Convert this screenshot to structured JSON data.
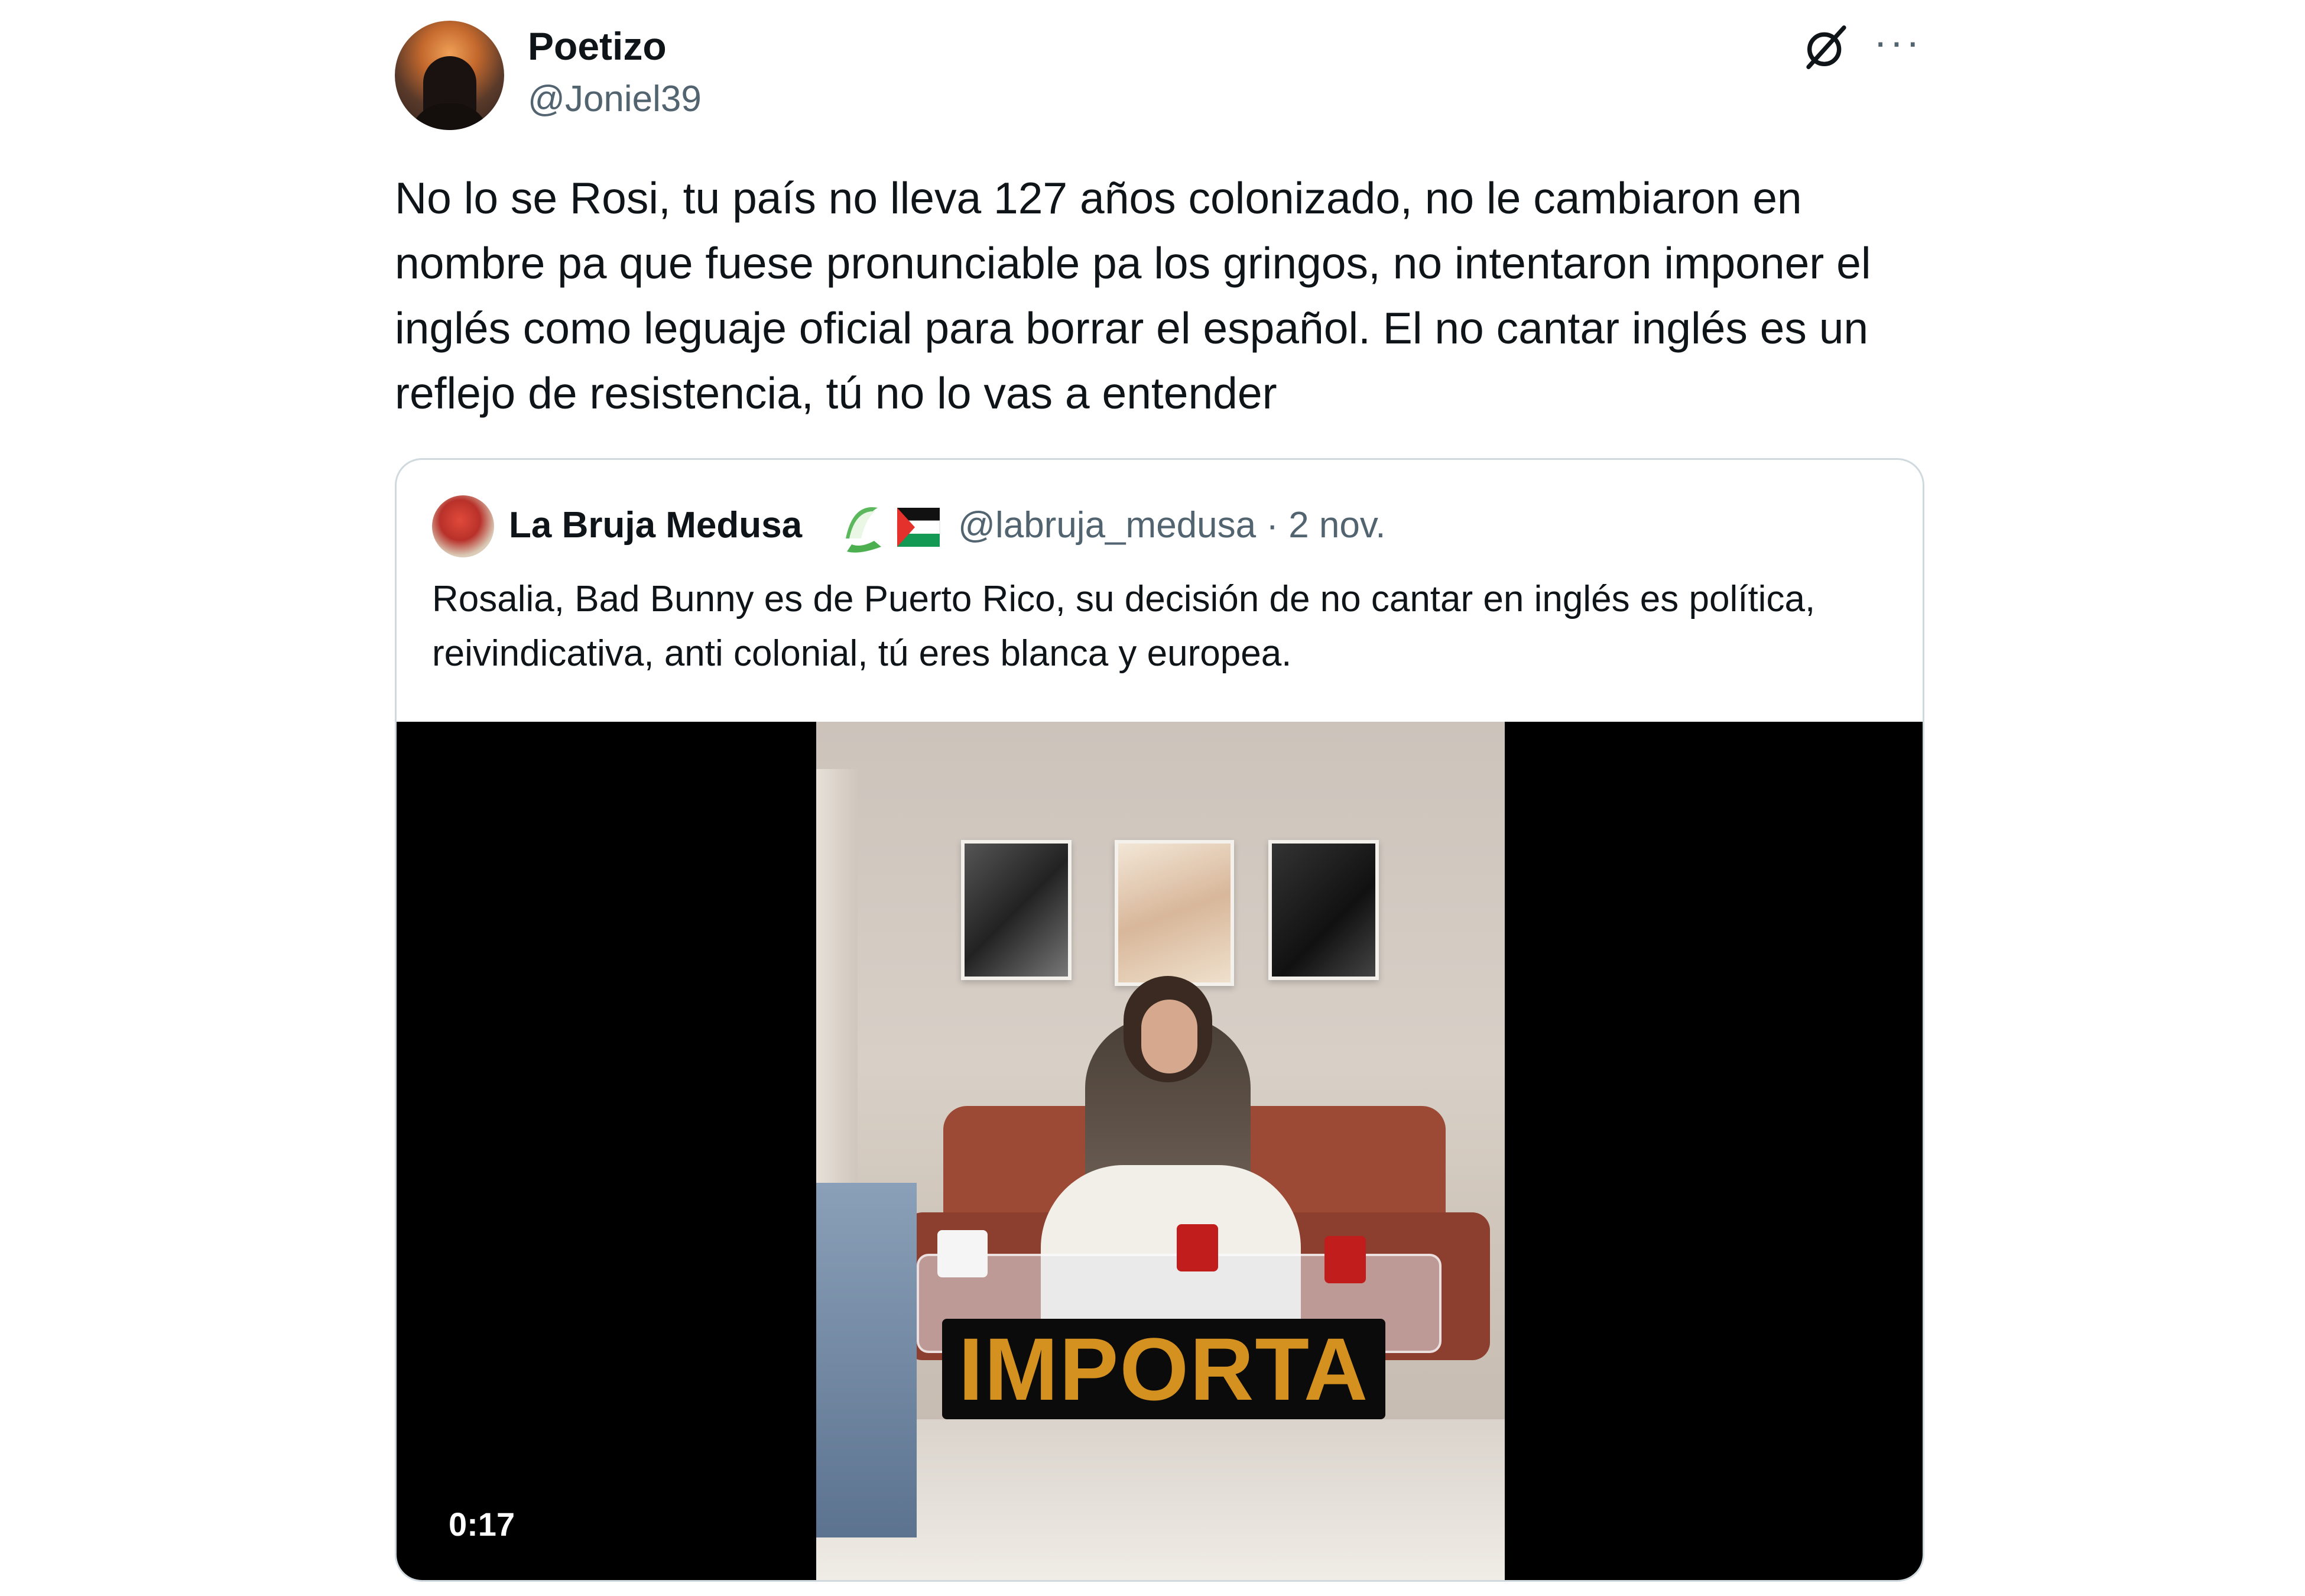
{
  "tweet": {
    "display_name": "Poetizo",
    "handle": "@Joniel39",
    "text": "No lo se Rosi, tu país no lleva 127 años colonizado, no le cambiaron en nombre pa que fuese pronunciable pa los gringos, no intentaron imponer el inglés como leguaje oficial para borrar el español. El no cantar inglés es un reflejo de resistencia, tú no lo vas a entender",
    "icons": [
      "grok-icon",
      "more-icon"
    ]
  },
  "quote": {
    "display_name": "La Bruja Medusa",
    "handle_date": "@labruja_medusa · 2 nov.",
    "emoji": [
      "watermelon-slice-emoji",
      "palestine-flag-emoji"
    ],
    "text": "Rosalia, Bad Bunny es de Puerto Rico, su decisión de no cantar en inglés es política, reivindicativa, anti colonial, tú eres blanca y europea.",
    "video": {
      "caption": "IMPORTA",
      "timecode": "0:17"
    }
  },
  "colors": {
    "text_primary": "#0f1419",
    "text_secondary": "#536471",
    "card_border": "#cfd9de",
    "caption_color": "#d4911f"
  }
}
